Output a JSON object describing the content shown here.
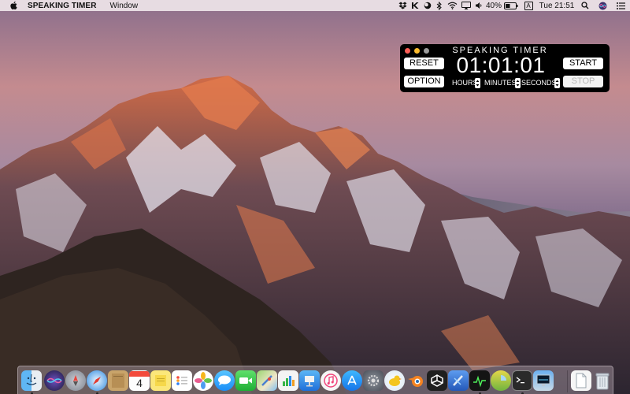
{
  "menubar": {
    "app_name": "SPEAKING TIMER",
    "menus": [
      "Window"
    ],
    "battery_percent": "40%",
    "clock": "Tue 21:51",
    "status_icons": [
      "dropbox-icon",
      "k-icon",
      "moon-icon",
      "bluetooth-icon",
      "wifi-icon",
      "airplay-icon",
      "volume-icon",
      "battery-icon",
      "input-source-icon",
      "search-icon",
      "siri-icon",
      "list-icon"
    ],
    "input_source_label": "A"
  },
  "timer": {
    "title": "SPEAKING TIMER",
    "time": "01:01:01",
    "reset_label": "RESET",
    "option_label": "OPTION",
    "start_label": "START",
    "stop_label": "STOP",
    "units": {
      "hours": "HOURS",
      "minutes": "MINUTES",
      "seconds": "SECONDS"
    },
    "calendar_day": "4"
  },
  "dock": {
    "apps": [
      "finder-icon",
      "siri-icon",
      "launchpad-icon",
      "safari-icon",
      "notes-icon",
      "calendar-icon",
      "stickies-icon",
      "reminders-icon",
      "photos-icon",
      "messages-icon",
      "facetime-icon",
      "maps-icon",
      "numbers-icon",
      "keynote-icon",
      "itunes-icon",
      "app-store-icon",
      "system-preferences-icon",
      "cyberduck-icon",
      "blender-icon",
      "unity-icon",
      "xcode-icon",
      "activity-monitor-icon",
      "disk-utility-icon",
      "terminal-icon",
      "network-utility-icon",
      "document-icon",
      "trash-icon"
    ]
  },
  "colors": {
    "menubar_bg": "#eee4e8",
    "timer_bg": "#000000",
    "close_red": "#fc5f57",
    "minimize_yellow": "#fdbc2e"
  }
}
